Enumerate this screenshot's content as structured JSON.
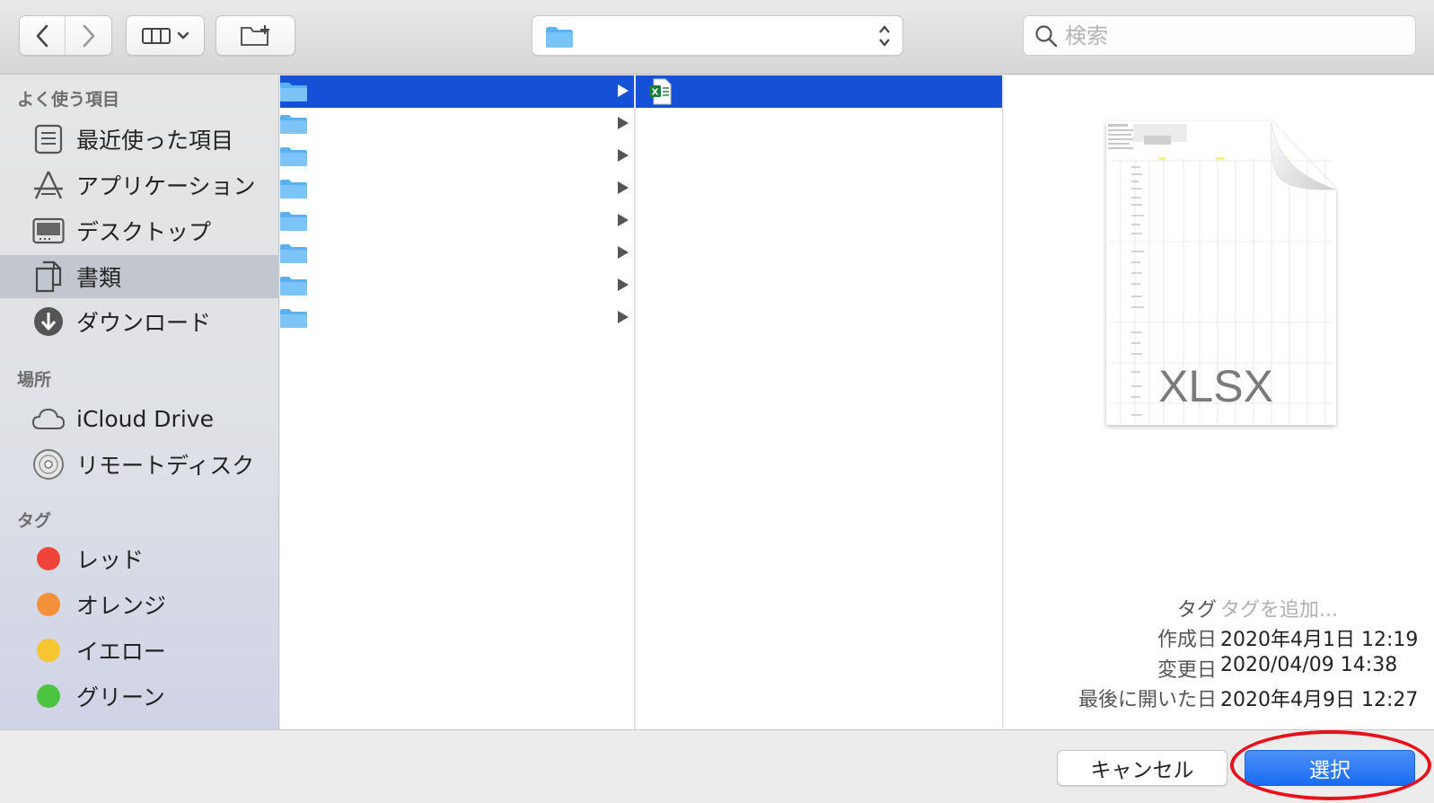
{
  "toolbar": {
    "back_icon": "chevron-left-icon",
    "forward_icon": "chevron-right-icon",
    "view_icon": "column-view-icon",
    "new_folder_icon": "new-folder-icon",
    "path_icon": "folder-icon",
    "path_value": "",
    "search_placeholder": "検索"
  },
  "sidebar": {
    "favorites_header": "よく使う項目",
    "favorites": [
      {
        "label": "最近使った項目",
        "icon": "recents-icon"
      },
      {
        "label": "アプリケーション",
        "icon": "applications-icon"
      },
      {
        "label": "デスクトップ",
        "icon": "desktop-icon"
      },
      {
        "label": "書類",
        "icon": "documents-icon",
        "selected": true
      },
      {
        "label": "ダウンロード",
        "icon": "downloads-icon"
      }
    ],
    "locations_header": "場所",
    "locations": [
      {
        "label": "iCloud Drive",
        "icon": "cloud-icon"
      },
      {
        "label": "リモートディスク",
        "icon": "disc-icon"
      }
    ],
    "tags_header": "タグ",
    "tags": [
      {
        "label": "レッド",
        "color": "#f0443b"
      },
      {
        "label": "オレンジ",
        "color": "#f5913a"
      },
      {
        "label": "イエロー",
        "color": "#f6c631"
      },
      {
        "label": "グリーン",
        "color": "#4cc441"
      }
    ]
  },
  "preview": {
    "file_type": "XLSX",
    "tag_label": "タグ",
    "tag_placeholder": "タグを追加...",
    "created_label": "作成日",
    "created_value": "2020年4月1日 12:19",
    "modified_label": "変更日",
    "modified_value": "2020/04/09 14:38",
    "last_opened_label": "最後に開いた日",
    "last_opened_value": "2020年4月9日 12:27"
  },
  "buttons": {
    "cancel": "キャンセル",
    "select": "選択"
  },
  "colors": {
    "selection": "#1451d6",
    "primary_button": "#1a6cf3",
    "annotation_ring": "#e8101b"
  }
}
